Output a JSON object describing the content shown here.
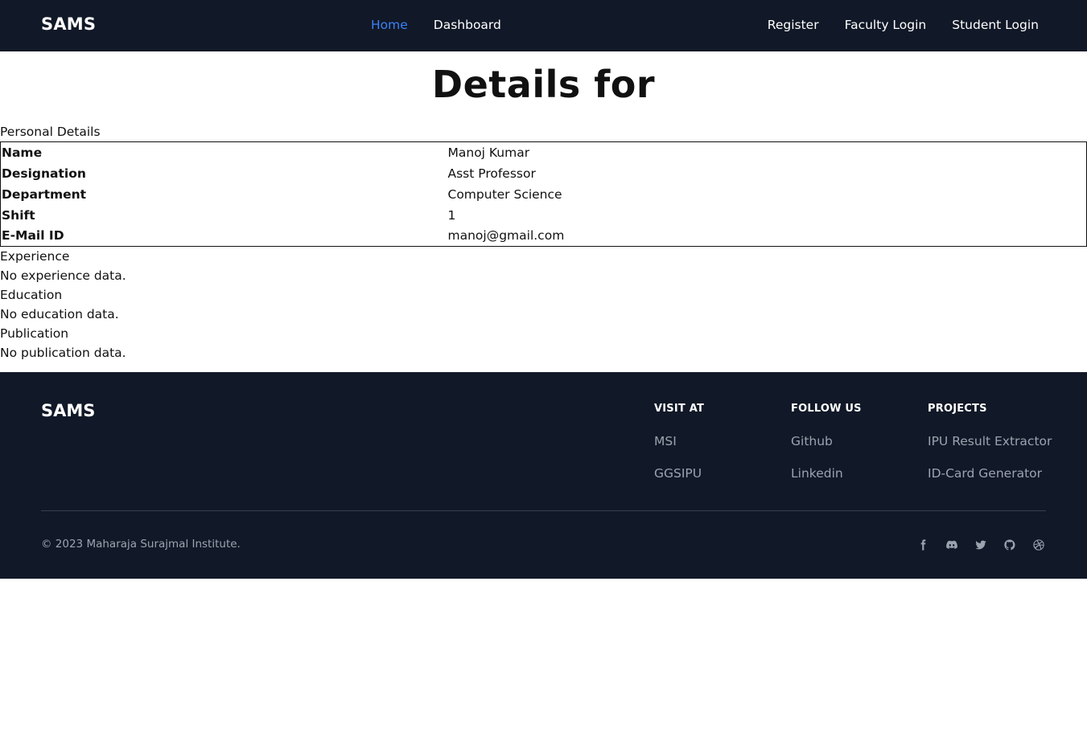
{
  "navbar": {
    "brand": "SAMS",
    "links_center": [
      "Home",
      "Dashboard"
    ],
    "links_right": [
      "Register",
      "Faculty Login",
      "Student Login"
    ],
    "active": "Home",
    "active_color": "#3b82f6"
  },
  "main": {
    "title": "Details for",
    "personal_caption": "Personal Details",
    "personal_rows": [
      {
        "key": "Name",
        "value": "Manoj Kumar"
      },
      {
        "key": "Designation",
        "value": "Asst Professor"
      },
      {
        "key": "Department",
        "value": "Computer Science"
      },
      {
        "key": "Shift",
        "value": "1"
      },
      {
        "key": "E-Mail ID",
        "value": "manoj@gmail.com"
      }
    ],
    "experience_caption": "Experience",
    "experience_empty": "No experience data.",
    "education_caption": "Education",
    "education_empty": "No education data.",
    "publication_caption": "Publication",
    "publication_empty": "No publication data."
  },
  "footer": {
    "brand": "SAMS",
    "visit": {
      "heading": "VISIT AT",
      "links": [
        "MSI",
        "GGSIPU"
      ]
    },
    "follow": {
      "heading": "FOLLOW US",
      "links": [
        "Github",
        "Linkedin"
      ]
    },
    "projects": {
      "heading": "PROJECTS",
      "links": [
        "IPU Result Extractor",
        "ID-Card Generator"
      ]
    },
    "copyright": "© 2023 Maharaja Surajmal Institute.",
    "social_icons": [
      "facebook-icon",
      "discord-icon",
      "twitter-icon",
      "github-icon",
      "dribbble-icon"
    ],
    "background": "#111827"
  }
}
